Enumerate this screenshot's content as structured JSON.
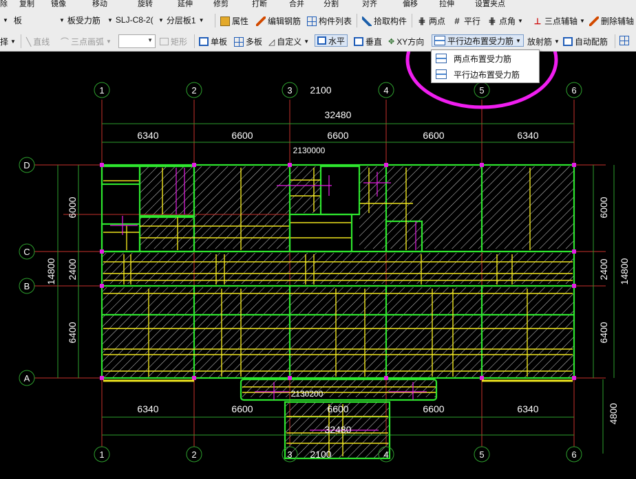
{
  "toolbar_top": {
    "items": [
      "除",
      "复制",
      "镜像",
      "移动",
      "旋转",
      "延伸",
      "修剪",
      "打断",
      "合并",
      "分割",
      "对齐",
      "偏移",
      "拉伸",
      "设置夹点"
    ]
  },
  "toolbar_main": {
    "layer_select": "板",
    "type_select": "板受力筋",
    "name_select": "SLJ-C8-2(",
    "floor_select": "分层板1",
    "properties": "属性",
    "edit_rebar": "编辑钢筋",
    "component_list": "构件列表",
    "pick_component": "拾取构件",
    "two_point": "两点",
    "parallel": "平行",
    "point_angle": "点角",
    "three_point_axis": "三点辅轴",
    "delete_axis": "删除辅轴"
  },
  "toolbar_draw": {
    "select": "择",
    "line": "直线",
    "arc": "三点画弧",
    "combo_value": "",
    "rect": "矩形",
    "single_board": "单板",
    "multi_board": "多板",
    "custom": "自定义",
    "horizontal": "水平",
    "vertical": "垂直",
    "xy_direction": "XY方向",
    "parallel_edge": "平行边布置受力筋",
    "radial": "放射筋",
    "auto_rebar": "自动配筋"
  },
  "dropdown_menu": {
    "items": [
      "两点布置受力筋",
      "平行边布置受力筋"
    ]
  },
  "drawing": {
    "axes_top": [
      "1",
      "2",
      "3",
      "4",
      "5",
      "6"
    ],
    "axes_side": [
      "D",
      "C",
      "B",
      "A"
    ],
    "dim_total": "32480",
    "dim_total_bottom": "32480",
    "dim_spans": [
      "6340",
      "6600",
      "6600",
      "6600",
      "6340"
    ],
    "dim_spans_bottom": [
      "6340",
      "6600",
      "6600",
      "6600",
      "6340"
    ],
    "dim_top_partial": "2100",
    "dim_bottom_partial": "2100",
    "dim_vertical": [
      "6000",
      "2400",
      "6400"
    ],
    "dim_vertical_total": "14800",
    "dim_extension": "4800",
    "overlap_top": "2130000",
    "overlap_bottom": "2130200",
    "colors": {
      "highlight_circle": "#f01ef0",
      "slab_outline": "#2ee62e",
      "rebar": "#f0e61e",
      "axis": "#c8322d",
      "dimension": "#2ea02e",
      "magenta": "#e61ee6",
      "hatch": "#d8d8d8"
    }
  }
}
